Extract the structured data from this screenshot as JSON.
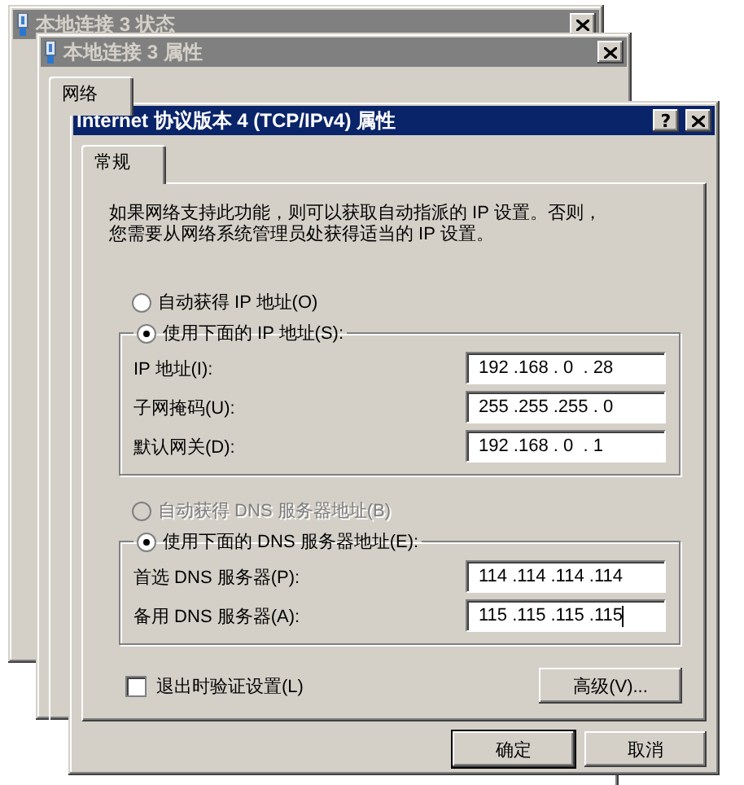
{
  "windows_behind": [
    {
      "title": "本地连接 3 状态"
    },
    {
      "title": "本地连接 3 属性",
      "tabs": [
        {
          "label": "网络",
          "selected": true
        }
      ]
    }
  ],
  "dialog": {
    "title": "Internet 协议版本 4 (TCP/IPv4) 属性",
    "help": "?",
    "tabs": [
      {
        "label": "常规",
        "selected": true
      }
    ],
    "description": "如果网络支持此功能，则可以获取自动指派的 IP 设置。否则，您需要从网络系统管理员处获得适当的 IP 设置。",
    "ip_options": [
      {
        "label": "自动获得 IP 地址(O)",
        "selected": false,
        "disabled": false
      },
      {
        "label": "使用下面的 IP 地址(S):",
        "selected": true,
        "disabled": false
      }
    ],
    "ip_fields": [
      {
        "label": "IP 地址(I):",
        "value": "192 .168 . 0  . 28",
        "focused": false
      },
      {
        "label": "子网掩码(U):",
        "value": "255 .255 .255 . 0",
        "focused": false
      },
      {
        "label": "默认网关(D):",
        "value": "192 .168 . 0  . 1",
        "focused": false
      }
    ],
    "dns_options": [
      {
        "label": "自动获得 DNS 服务器地址(B)",
        "selected": false,
        "disabled": true
      },
      {
        "label": "使用下面的 DNS 服务器地址(E):",
        "selected": true,
        "disabled": false
      }
    ],
    "dns_fields": [
      {
        "label": "首选 DNS 服务器(P):",
        "value": "114 .114 .114 .114",
        "focused": false
      },
      {
        "label": "备用 DNS 服务器(A):",
        "value": "115 .115 .115 .115",
        "focused": true
      }
    ],
    "validate_on_exit": {
      "label": "退出时验证设置(L)",
      "checked": false
    },
    "advanced_button": "高级(V)...",
    "buttons": [
      {
        "label": "确定",
        "default": true
      },
      {
        "label": "取消",
        "default": false
      }
    ]
  }
}
